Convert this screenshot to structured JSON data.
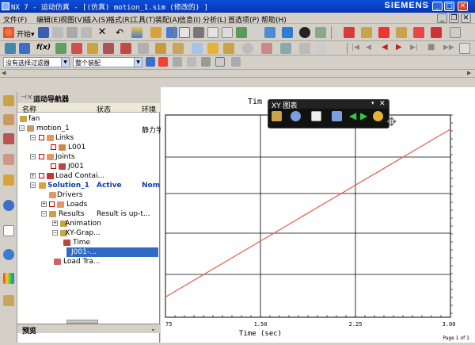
{
  "window": {
    "title": "NX 7 - 运动仿真 - [(仿真) motion_1.sim  (修改的) ]",
    "brand": "SIEMENS"
  },
  "menu": [
    "文件(F)",
    "编辑(E)",
    "视图(V)",
    "插入(S)",
    "格式(R)",
    "工具(T)",
    "装配(A)",
    "信息(I)",
    "分析(L)",
    "首选项(P)",
    "帮助(H)"
  ],
  "toolbar": {
    "start_label": "开始▾",
    "filter_value": "没有选择过滤器",
    "scope_value": "整个装配"
  },
  "navigator": {
    "title": "运动导航器",
    "columns": [
      "名称",
      "状态",
      "环境"
    ],
    "rows": [
      {
        "name": "fan",
        "status": "",
        "env": ""
      },
      {
        "name": "motion_1",
        "status": "",
        "env": "静力学"
      },
      {
        "name": "Links",
        "status": "",
        "env": ""
      },
      {
        "name": "L001",
        "status": "",
        "env": ""
      },
      {
        "name": "Joints",
        "status": "",
        "env": ""
      },
      {
        "name": "J001",
        "status": "",
        "env": ""
      },
      {
        "name": "Load Contai...",
        "status": "",
        "env": ""
      },
      {
        "name": "Solution_1",
        "status": "Active",
        "env": "Nom"
      },
      {
        "name": "Drivers",
        "status": "",
        "env": ""
      },
      {
        "name": "Loads",
        "status": "",
        "env": ""
      },
      {
        "name": "Results",
        "status": "Result is up-t...",
        "env": ""
      },
      {
        "name": "Animation",
        "status": "",
        "env": ""
      },
      {
        "name": "XY-Grap...",
        "status": "",
        "env": ""
      },
      {
        "name": "Time",
        "status": "",
        "env": ""
      },
      {
        "name": "J001-...",
        "status": "",
        "env": ""
      },
      {
        "name": "Load Tra...",
        "status": "",
        "env": ""
      }
    ],
    "preview_label": "预览"
  },
  "xy_panel": {
    "title": "XY 图表"
  },
  "chart_data": {
    "type": "line",
    "title": "Tim",
    "xlabel": "Time (sec)",
    "ylabel": "",
    "xlim": [
      0.75,
      3.0
    ],
    "x_ticks": [
      "75",
      "1.50",
      "2.25",
      "3.00"
    ],
    "grid": true,
    "page_label": "Page 1 of 1",
    "series": [
      {
        "x": [
          0.75,
          3.0
        ],
        "y": [
          0.1,
          0.93
        ],
        "color": "#e85a4f"
      }
    ]
  }
}
